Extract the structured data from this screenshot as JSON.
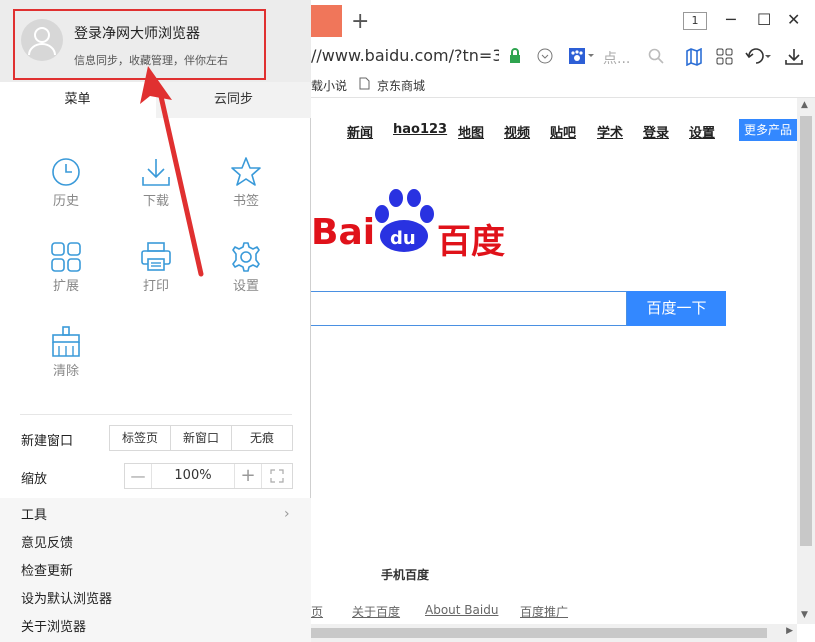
{
  "browser": {
    "tab_count": "1",
    "new_tab_glyph": "+",
    "url": "//www.baidu.com/?tn=3",
    "search_placeholder": "点...",
    "window_controls": {
      "minimize": "─",
      "maximize": "☐",
      "close": "✕"
    }
  },
  "bookmarks": [
    {
      "label": "载小说"
    },
    {
      "label": "京东商城"
    }
  ],
  "baidu": {
    "nav": [
      "新闻",
      "hao123",
      "地图",
      "视频",
      "贴吧",
      "学术",
      "登录",
      "设置"
    ],
    "more_button": "更多产品",
    "logo_bai": "Bai",
    "logo_du": "du",
    "logo_cn": "百度",
    "search_button": "百度一下",
    "mobile": "手机百度",
    "footer": [
      "页",
      "关于百度",
      "About Baidu",
      "百度推广"
    ]
  },
  "panel": {
    "login_title": "登录净网大师浏览器",
    "login_subtitle": "信息同步，收藏管理，伴你左右",
    "tabs": {
      "menu": "菜单",
      "sync": "云同步"
    },
    "grid": {
      "history": "历史",
      "download": "下载",
      "bookmark": "书签",
      "extensions": "扩展",
      "print": "打印",
      "settings": "设置",
      "clear": "清除"
    },
    "new_window": {
      "label": "新建窗口",
      "options": [
        "标签页",
        "新窗口",
        "无痕"
      ]
    },
    "zoom": {
      "label": "缩放",
      "minus": "—",
      "value": "100%",
      "plus": "+"
    },
    "menu": [
      "工具",
      "意见反馈",
      "检查更新",
      "设为默认浏览器",
      "关于浏览器"
    ],
    "tools_chevron": "›"
  },
  "colors": {
    "accent_blue": "#3388ff",
    "icon_blue": "#3a9ad9",
    "highlight_red": "#e03030",
    "baidu_red": "#e0121a",
    "tab_orange": "#f0765a"
  }
}
